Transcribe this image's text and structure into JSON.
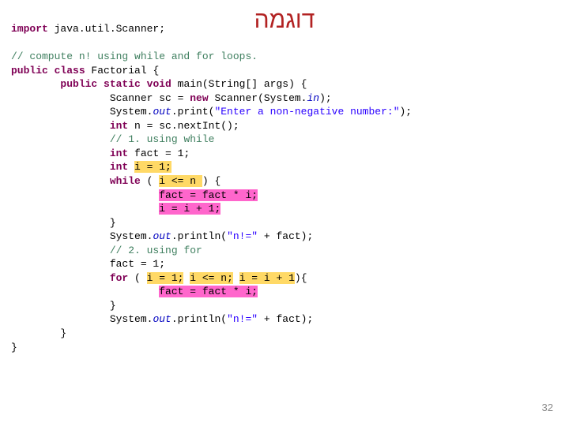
{
  "title": "דוגמה",
  "pagenum": "32",
  "code": {
    "l1a": "import",
    "l1b": " java.util.Scanner;",
    "l3": "// compute n! using while and for loops.",
    "l4a": "public class",
    "l4b": " Factorial {",
    "l5a": "public static void",
    "l5b": " main(String[] args) {",
    "l6a": "Scanner sc = ",
    "l6b": "new",
    "l6c": " Scanner(System.",
    "l6d": "in",
    "l6e": ");",
    "l7a": "System.",
    "l7b": "out",
    "l7c": ".print(",
    "l7d": "\"Enter a non-negative number:\"",
    "l7e": ");",
    "l8a": "int",
    "l8b": " n = sc.nextInt();",
    "l9": "// 1. using while",
    "l10a": "int",
    "l10b": " fact = 1;",
    "l11a": "int",
    "l11b": " ",
    "l11c": "i = 1;",
    "l12a": "while",
    "l12b": " ( ",
    "l12c": "i <= n ",
    "l12d": ") {",
    "l13": "fact = fact * i;",
    "l14": "i = i + 1;",
    "l15": "}",
    "l16a": "System.",
    "l16b": "out",
    "l16c": ".println(",
    "l16d": "\"n!=\"",
    "l16e": " + fact);",
    "l17": "// 2. using for",
    "l18": "fact = 1;",
    "l19a": "for",
    "l19b": " ( ",
    "l19c": "i = 1;",
    "l19d": " ",
    "l19e": "i <= n;",
    "l19f": " ",
    "l19g": "i = i + 1",
    "l19h": "){",
    "l20": "fact = fact * i;",
    "l21": "}",
    "l22a": "System.",
    "l22b": "out",
    "l22c": ".println(",
    "l22d": "\"n!=\"",
    "l22e": " + fact);",
    "l23": "}",
    "l24": "}"
  }
}
